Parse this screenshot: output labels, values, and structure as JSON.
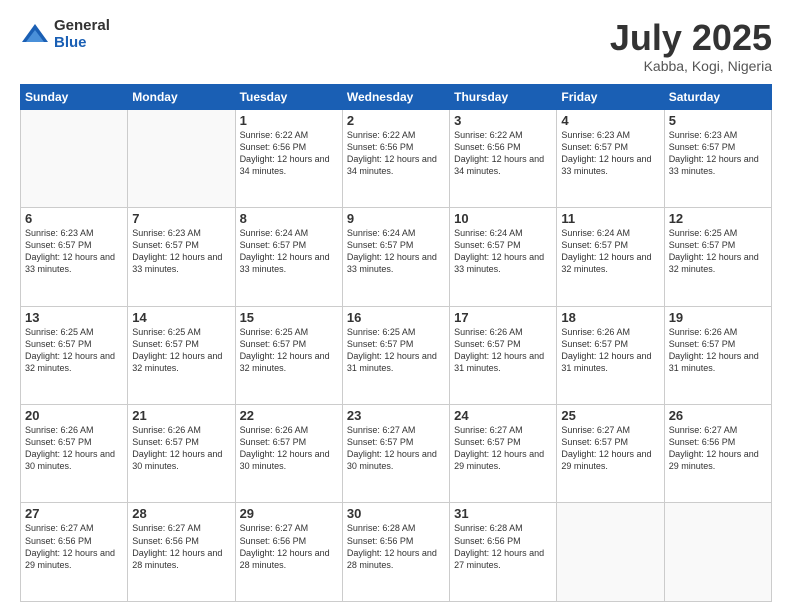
{
  "header": {
    "logo_general": "General",
    "logo_blue": "Blue",
    "month_title": "July 2025",
    "location": "Kabba, Kogi, Nigeria"
  },
  "days_of_week": [
    "Sunday",
    "Monday",
    "Tuesday",
    "Wednesday",
    "Thursday",
    "Friday",
    "Saturday"
  ],
  "weeks": [
    [
      {
        "day": "",
        "empty": true
      },
      {
        "day": "",
        "empty": true
      },
      {
        "day": "1",
        "sunrise": "Sunrise: 6:22 AM",
        "sunset": "Sunset: 6:56 PM",
        "daylight": "Daylight: 12 hours and 34 minutes."
      },
      {
        "day": "2",
        "sunrise": "Sunrise: 6:22 AM",
        "sunset": "Sunset: 6:56 PM",
        "daylight": "Daylight: 12 hours and 34 minutes."
      },
      {
        "day": "3",
        "sunrise": "Sunrise: 6:22 AM",
        "sunset": "Sunset: 6:56 PM",
        "daylight": "Daylight: 12 hours and 34 minutes."
      },
      {
        "day": "4",
        "sunrise": "Sunrise: 6:23 AM",
        "sunset": "Sunset: 6:57 PM",
        "daylight": "Daylight: 12 hours and 33 minutes."
      },
      {
        "day": "5",
        "sunrise": "Sunrise: 6:23 AM",
        "sunset": "Sunset: 6:57 PM",
        "daylight": "Daylight: 12 hours and 33 minutes."
      }
    ],
    [
      {
        "day": "6",
        "sunrise": "Sunrise: 6:23 AM",
        "sunset": "Sunset: 6:57 PM",
        "daylight": "Daylight: 12 hours and 33 minutes."
      },
      {
        "day": "7",
        "sunrise": "Sunrise: 6:23 AM",
        "sunset": "Sunset: 6:57 PM",
        "daylight": "Daylight: 12 hours and 33 minutes."
      },
      {
        "day": "8",
        "sunrise": "Sunrise: 6:24 AM",
        "sunset": "Sunset: 6:57 PM",
        "daylight": "Daylight: 12 hours and 33 minutes."
      },
      {
        "day": "9",
        "sunrise": "Sunrise: 6:24 AM",
        "sunset": "Sunset: 6:57 PM",
        "daylight": "Daylight: 12 hours and 33 minutes."
      },
      {
        "day": "10",
        "sunrise": "Sunrise: 6:24 AM",
        "sunset": "Sunset: 6:57 PM",
        "daylight": "Daylight: 12 hours and 33 minutes."
      },
      {
        "day": "11",
        "sunrise": "Sunrise: 6:24 AM",
        "sunset": "Sunset: 6:57 PM",
        "daylight": "Daylight: 12 hours and 32 minutes."
      },
      {
        "day": "12",
        "sunrise": "Sunrise: 6:25 AM",
        "sunset": "Sunset: 6:57 PM",
        "daylight": "Daylight: 12 hours and 32 minutes."
      }
    ],
    [
      {
        "day": "13",
        "sunrise": "Sunrise: 6:25 AM",
        "sunset": "Sunset: 6:57 PM",
        "daylight": "Daylight: 12 hours and 32 minutes."
      },
      {
        "day": "14",
        "sunrise": "Sunrise: 6:25 AM",
        "sunset": "Sunset: 6:57 PM",
        "daylight": "Daylight: 12 hours and 32 minutes."
      },
      {
        "day": "15",
        "sunrise": "Sunrise: 6:25 AM",
        "sunset": "Sunset: 6:57 PM",
        "daylight": "Daylight: 12 hours and 32 minutes."
      },
      {
        "day": "16",
        "sunrise": "Sunrise: 6:25 AM",
        "sunset": "Sunset: 6:57 PM",
        "daylight": "Daylight: 12 hours and 31 minutes."
      },
      {
        "day": "17",
        "sunrise": "Sunrise: 6:26 AM",
        "sunset": "Sunset: 6:57 PM",
        "daylight": "Daylight: 12 hours and 31 minutes."
      },
      {
        "day": "18",
        "sunrise": "Sunrise: 6:26 AM",
        "sunset": "Sunset: 6:57 PM",
        "daylight": "Daylight: 12 hours and 31 minutes."
      },
      {
        "day": "19",
        "sunrise": "Sunrise: 6:26 AM",
        "sunset": "Sunset: 6:57 PM",
        "daylight": "Daylight: 12 hours and 31 minutes."
      }
    ],
    [
      {
        "day": "20",
        "sunrise": "Sunrise: 6:26 AM",
        "sunset": "Sunset: 6:57 PM",
        "daylight": "Daylight: 12 hours and 30 minutes."
      },
      {
        "day": "21",
        "sunrise": "Sunrise: 6:26 AM",
        "sunset": "Sunset: 6:57 PM",
        "daylight": "Daylight: 12 hours and 30 minutes."
      },
      {
        "day": "22",
        "sunrise": "Sunrise: 6:26 AM",
        "sunset": "Sunset: 6:57 PM",
        "daylight": "Daylight: 12 hours and 30 minutes."
      },
      {
        "day": "23",
        "sunrise": "Sunrise: 6:27 AM",
        "sunset": "Sunset: 6:57 PM",
        "daylight": "Daylight: 12 hours and 30 minutes."
      },
      {
        "day": "24",
        "sunrise": "Sunrise: 6:27 AM",
        "sunset": "Sunset: 6:57 PM",
        "daylight": "Daylight: 12 hours and 29 minutes."
      },
      {
        "day": "25",
        "sunrise": "Sunrise: 6:27 AM",
        "sunset": "Sunset: 6:57 PM",
        "daylight": "Daylight: 12 hours and 29 minutes."
      },
      {
        "day": "26",
        "sunrise": "Sunrise: 6:27 AM",
        "sunset": "Sunset: 6:56 PM",
        "daylight": "Daylight: 12 hours and 29 minutes."
      }
    ],
    [
      {
        "day": "27",
        "sunrise": "Sunrise: 6:27 AM",
        "sunset": "Sunset: 6:56 PM",
        "daylight": "Daylight: 12 hours and 29 minutes."
      },
      {
        "day": "28",
        "sunrise": "Sunrise: 6:27 AM",
        "sunset": "Sunset: 6:56 PM",
        "daylight": "Daylight: 12 hours and 28 minutes."
      },
      {
        "day": "29",
        "sunrise": "Sunrise: 6:27 AM",
        "sunset": "Sunset: 6:56 PM",
        "daylight": "Daylight: 12 hours and 28 minutes."
      },
      {
        "day": "30",
        "sunrise": "Sunrise: 6:28 AM",
        "sunset": "Sunset: 6:56 PM",
        "daylight": "Daylight: 12 hours and 28 minutes."
      },
      {
        "day": "31",
        "sunrise": "Sunrise: 6:28 AM",
        "sunset": "Sunset: 6:56 PM",
        "daylight": "Daylight: 12 hours and 27 minutes."
      },
      {
        "day": "",
        "empty": true
      },
      {
        "day": "",
        "empty": true
      }
    ]
  ]
}
